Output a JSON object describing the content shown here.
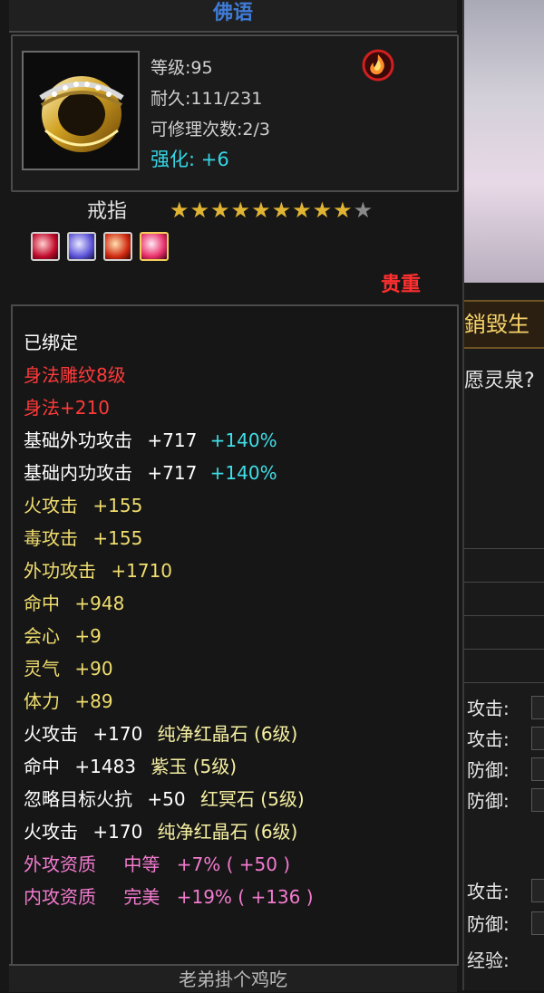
{
  "header": {
    "title": "佛语"
  },
  "item": {
    "level_text": "等级:95",
    "durability_text": "耐久:111/231",
    "repair_text": "可修理次数:2/3",
    "enhance_label": "强化:",
    "enhance_value": "+6",
    "type": "戒指",
    "stars": "★★★★★★★★★",
    "star_empty": "★",
    "rarity": "贵重"
  },
  "attributes": [
    {
      "label": "已绑定",
      "value": "",
      "extra": ""
    },
    {
      "label": "身法雕纹8级",
      "value": "",
      "extra": ""
    },
    {
      "label": "身法+210",
      "value": "",
      "extra": ""
    },
    {
      "label": "基础外功攻击",
      "value": "+717",
      "extra": "+140%"
    },
    {
      "label": "基础内功攻击",
      "value": "+717",
      "extra": "+140%"
    },
    {
      "label": "火攻击",
      "value": "+155",
      "extra": ""
    },
    {
      "label": "毒攻击",
      "value": "+155",
      "extra": ""
    },
    {
      "label": "外功攻击",
      "value": "+1710",
      "extra": ""
    },
    {
      "label": "命中",
      "value": "+948",
      "extra": ""
    },
    {
      "label": "会心",
      "value": "+9",
      "extra": ""
    },
    {
      "label": "灵气",
      "value": "+90",
      "extra": ""
    },
    {
      "label": "体力",
      "value": "+89",
      "extra": ""
    },
    {
      "label": "火攻击",
      "value": "+170",
      "extra": "纯净红晶石 (6级)"
    },
    {
      "label": "命中",
      "value": "+1483",
      "extra": "紫玉 (5级)"
    },
    {
      "label": "忽略目标火抗",
      "value": "+50",
      "extra": "红冥石 (5级)"
    },
    {
      "label": "火攻击",
      "value": "+170",
      "extra": "纯净红晶石 (6级)"
    },
    {
      "label": "外攻资质",
      "value": "中等",
      "extra": "+7% ( +50 )"
    },
    {
      "label": "内攻资质",
      "value": "完美",
      "extra": "+19% ( +136 )"
    }
  ],
  "bottom": {
    "text": "老弟掛个鸡吃"
  },
  "right": {
    "banner": "銷毀生",
    "dialog": "愿灵泉?",
    "labels": [
      "攻击:",
      "攻击:",
      "防御:",
      "防御:",
      "攻击:",
      "防御:",
      "经验:"
    ]
  },
  "icons": {
    "item_icon": "ring-icon",
    "badge_icon": "fire-badge-icon"
  }
}
